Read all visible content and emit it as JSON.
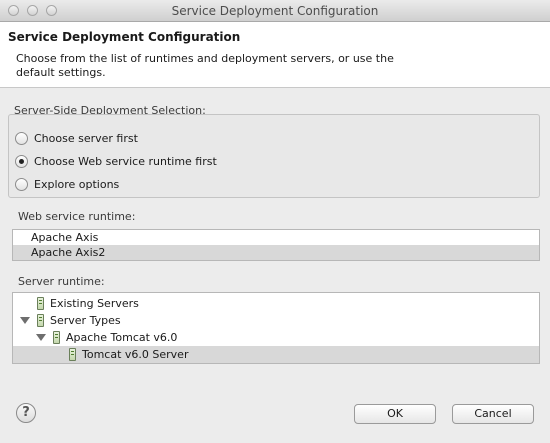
{
  "window": {
    "title": "Service Deployment Configuration"
  },
  "header": {
    "title": "Service Deployment Configuration",
    "description": "Choose from the list of runtimes and deployment servers, or use the default settings."
  },
  "selection": {
    "label": "Server-Side Deployment Selection:",
    "options": [
      {
        "label": "Choose server first",
        "checked": false
      },
      {
        "label": "Choose Web service runtime first",
        "checked": true
      },
      {
        "label": "Explore options",
        "checked": false
      }
    ]
  },
  "runtime": {
    "label": "Web service runtime:",
    "items": [
      "Apache Axis",
      "Apache Axis2"
    ],
    "selected": "Apache Axis2"
  },
  "server": {
    "label": "Server runtime:",
    "tree": [
      {
        "label": "Existing Servers",
        "level": 0,
        "expandable": false
      },
      {
        "label": "Server Types",
        "level": 0,
        "expandable": true
      },
      {
        "label": "Apache Tomcat v6.0",
        "level": 1,
        "expandable": true
      },
      {
        "label": "Tomcat v6.0 Server",
        "level": 2,
        "expandable": false
      }
    ],
    "selected": "Tomcat v6.0 Server"
  },
  "buttons": {
    "ok": "OK",
    "cancel": "Cancel",
    "help": "?"
  },
  "colors": {
    "selection": "#d8d8d8",
    "header_bg": "#ffffff",
    "dialog_bg": "#ececec"
  }
}
